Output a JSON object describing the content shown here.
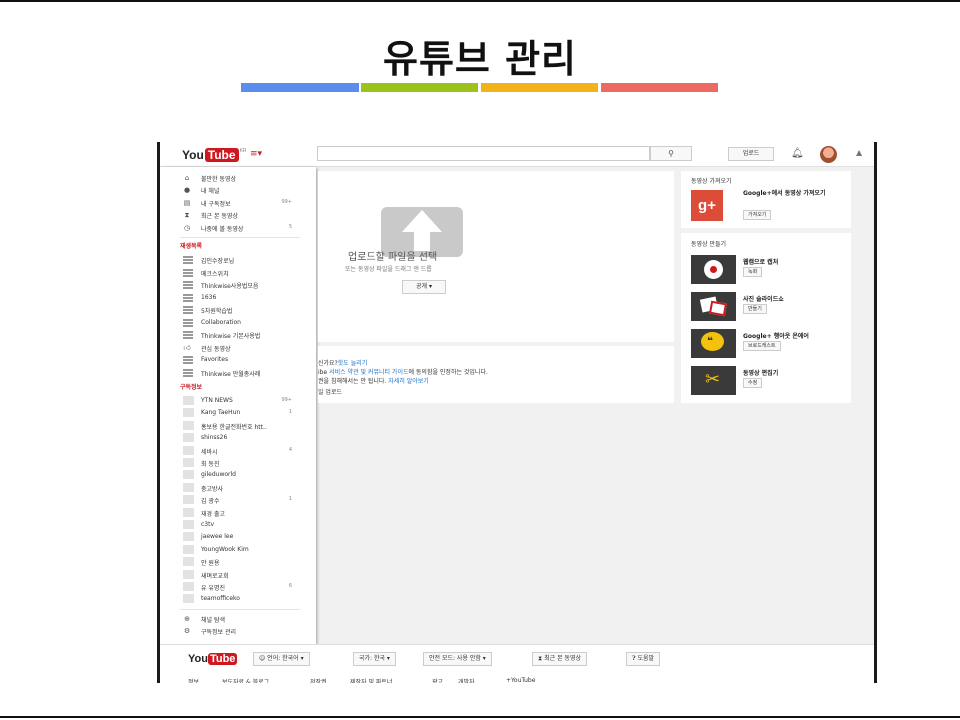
{
  "slide": {
    "title": "유튜브 관리",
    "colors": [
      "#5b8dee",
      "#9bc31c",
      "#f2b31a",
      "#ec6a61"
    ]
  },
  "header": {
    "logo_you": "You",
    "logo_tube": "Tube",
    "logo_region": "KR",
    "search_icon": "search-icon",
    "upload_label": "업로드",
    "bell_icon": "bell-icon"
  },
  "sidebar": {
    "nav": [
      {
        "icon": "home-icon",
        "glyph": "⌂",
        "label": "불만한 동영상",
        "count": ""
      },
      {
        "icon": "user-icon",
        "glyph": "●",
        "label": "내 채널",
        "count": ""
      },
      {
        "icon": "subscriptions-icon",
        "glyph": "▤",
        "label": "내 구독정보",
        "count": "99+"
      },
      {
        "icon": "history-icon",
        "glyph": "⧗",
        "label": "최근 본 동영상",
        "count": ""
      },
      {
        "icon": "clock-icon",
        "glyph": "◷",
        "label": "나중에 볼 동영상",
        "count": "5"
      }
    ],
    "playlist_heading": "재생목록",
    "playlists": [
      {
        "label": "김인수장로님",
        "count": ""
      },
      {
        "label": "메크스위치",
        "count": ""
      },
      {
        "label": "Thinkwise사용법모음",
        "count": ""
      },
      {
        "label": "1636",
        "count": ""
      },
      {
        "label": "5차원학습법",
        "count": ""
      },
      {
        "label": "Collaboration",
        "count": ""
      },
      {
        "label": "Thinkwise 기본사용법",
        "count": ""
      },
      {
        "label": "관심 동영상",
        "count": ""
      },
      {
        "label": "Favorites",
        "count": ""
      },
      {
        "label": "Thinkwise 만월총사례",
        "count": ""
      }
    ],
    "subs_heading": "구독정보",
    "subscriptions": [
      {
        "label": "YTN NEWS",
        "count": "99+"
      },
      {
        "label": "Kang TaeHun",
        "count": "1"
      },
      {
        "label": "홍보용 한글전화번호 htt..",
        "count": ""
      },
      {
        "label": "shinss26",
        "count": ""
      },
      {
        "label": "세바시",
        "count": "4"
      },
      {
        "label": "최 동진",
        "count": ""
      },
      {
        "label": "gileduworld",
        "count": ""
      },
      {
        "label": "충고방사",
        "count": ""
      },
      {
        "label": "김 광수",
        "count": "1"
      },
      {
        "label": "재경 출고",
        "count": ""
      },
      {
        "label": "c3tv",
        "count": ""
      },
      {
        "label": "jaewee lee",
        "count": ""
      },
      {
        "label": "YoungWook Kim",
        "count": ""
      },
      {
        "label": "안 원용",
        "count": ""
      },
      {
        "label": "새며로교회",
        "count": ""
      },
      {
        "label": "유 유명진",
        "count": "6"
      },
      {
        "label": "teamofficeko",
        "count": ""
      }
    ],
    "bottom": [
      {
        "icon": "browse-channels-icon",
        "glyph": "⊕",
        "label": "채널 탐색"
      },
      {
        "icon": "settings-icon",
        "glyph": "⚙",
        "label": "구독정보 관리"
      }
    ]
  },
  "upload": {
    "main_text": "업로드할 파일을 선택",
    "sub_text": "또는 동영상 파일을 드래그 앤 드롭",
    "privacy_label": "공개 ▾"
  },
  "info": {
    "line1_a": "신가요?",
    "line1_link": "핫도 늘리기",
    "line2_a": "ibe",
    "line2_link": "서비스 약관 및 커뮤니티 가이드",
    "line2_b": "에 동의함을 인정하는 것입니다.",
    "line3_a": "권을 침해해서는 안 됩니다.",
    "line3_link": "자세히 알아보기",
    "line4": "일 업로드"
  },
  "import_panel": {
    "title": "동영상 가져오기",
    "gplus_name": "Google+에서 동영상 가져오기",
    "gplus_button": "가져오기"
  },
  "create_panel": {
    "title": "동영상 만들기",
    "tools": [
      {
        "icon": "webcam-icon",
        "name": "웹캠으로 캡처",
        "button": "녹화"
      },
      {
        "icon": "photo-slideshow-icon",
        "name": "사진 슬라이드쇼",
        "button": "만들기"
      },
      {
        "icon": "hangouts-icon",
        "name": "Google+ 행아웃 온에어",
        "button": "브로드캐스트"
      },
      {
        "icon": "video-editor-icon",
        "name": "동영상 편집기",
        "button": "수정"
      }
    ]
  },
  "footer": {
    "logo_you": "You",
    "logo_tube": "Tube",
    "language": "언어: 한국어 ▾",
    "country": "국가: 한국 ▾",
    "safety": "안전 모드: 사용 안함 ▾",
    "history": "최근 본 동영상",
    "help": "도움말",
    "links": [
      "정보",
      "보도자료 & 블로그",
      "저작권",
      "제작자 및 파트너",
      "광고",
      "개발자",
      "+YouTube"
    ]
  }
}
